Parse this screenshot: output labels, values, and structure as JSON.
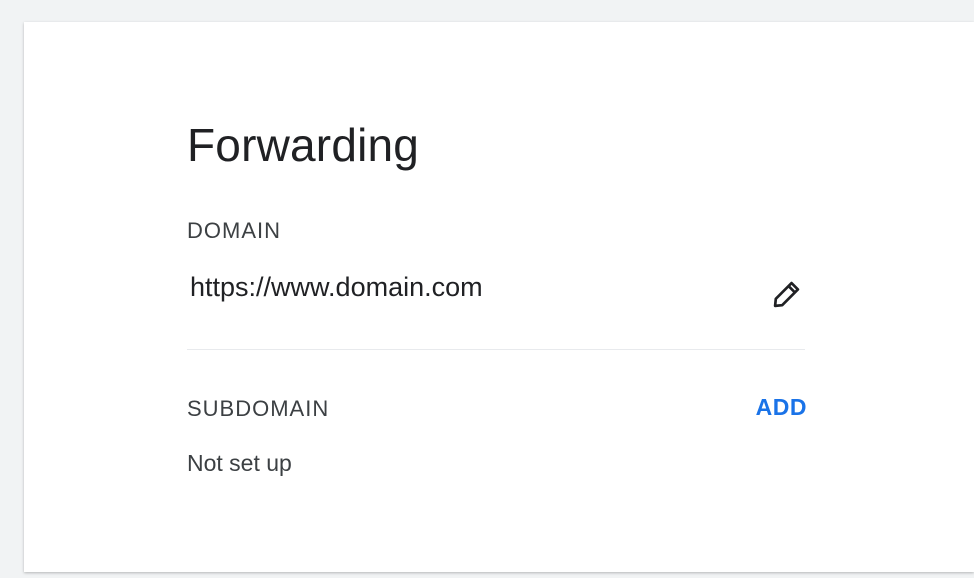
{
  "forwarding": {
    "title": "Forwarding",
    "domain": {
      "label": "DOMAIN",
      "value": "https://www.domain.com",
      "edit_icon": "pencil-icon"
    },
    "subdomain": {
      "label": "SUBDOMAIN",
      "action_label": "ADD",
      "value": "Not set up"
    }
  },
  "colors": {
    "accent": "#1a73e8",
    "text_primary": "#202124",
    "text_secondary": "#3c4043",
    "divider": "#e8eaed",
    "background": "#f1f3f4"
  }
}
